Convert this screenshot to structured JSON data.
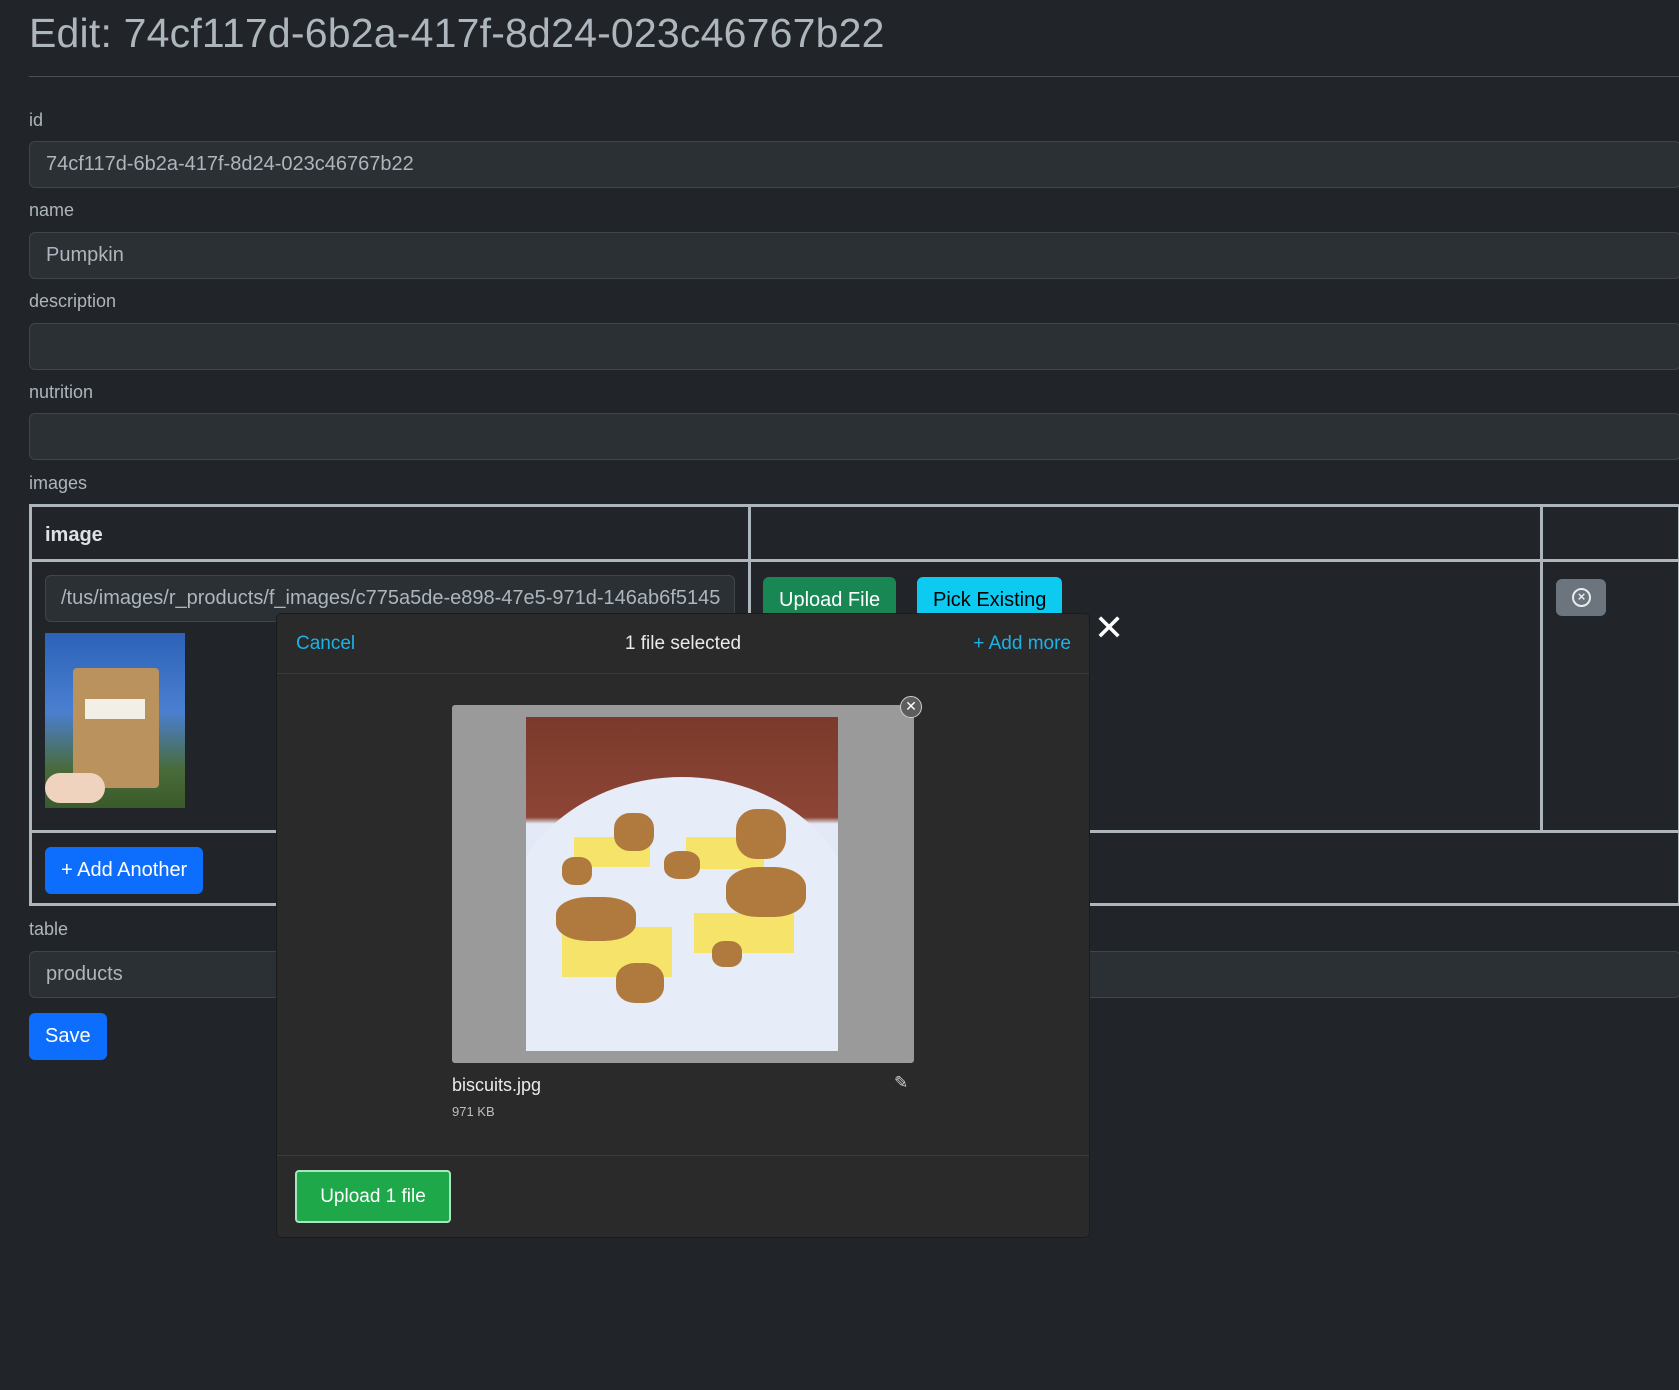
{
  "page": {
    "title": "Edit: 74cf117d-6b2a-417f-8d24-023c46767b22"
  },
  "form": {
    "id": {
      "label": "id",
      "value": "74cf117d-6b2a-417f-8d24-023c46767b22"
    },
    "name": {
      "label": "name",
      "value": "Pumpkin"
    },
    "description": {
      "label": "description",
      "value": ""
    },
    "nutrition": {
      "label": "nutrition",
      "value": ""
    },
    "images": {
      "label": "images",
      "header": "image",
      "row": {
        "path": "/tus/images/r_products/f_images/c775a5de-e898-47e5-971d-146ab6f5145",
        "upload_label": "Upload File",
        "pick_label": "Pick Existing"
      },
      "add_another_label": "+ Add Another"
    },
    "table": {
      "label": "table",
      "value": "products"
    },
    "save_label": "Save"
  },
  "modal": {
    "cancel_label": "Cancel",
    "count_label": "1 file selected",
    "add_more_label": "+ Add more",
    "close_symbol": "✕",
    "file": {
      "name": "biscuits.jpg",
      "size": "971 KB"
    },
    "upload_label": "Upload 1 file"
  },
  "icons": {
    "remove_row": "x-circle-icon",
    "close_modal": "close-icon",
    "remove_file": "close-icon",
    "edit_file": "pencil-icon"
  },
  "colors": {
    "background": "#212529",
    "primary": "#0d6efd",
    "success": "#198754",
    "info": "#0dcaf0",
    "uppy_link": "#1bb2e8",
    "uppy_upload": "#1ea84a"
  }
}
